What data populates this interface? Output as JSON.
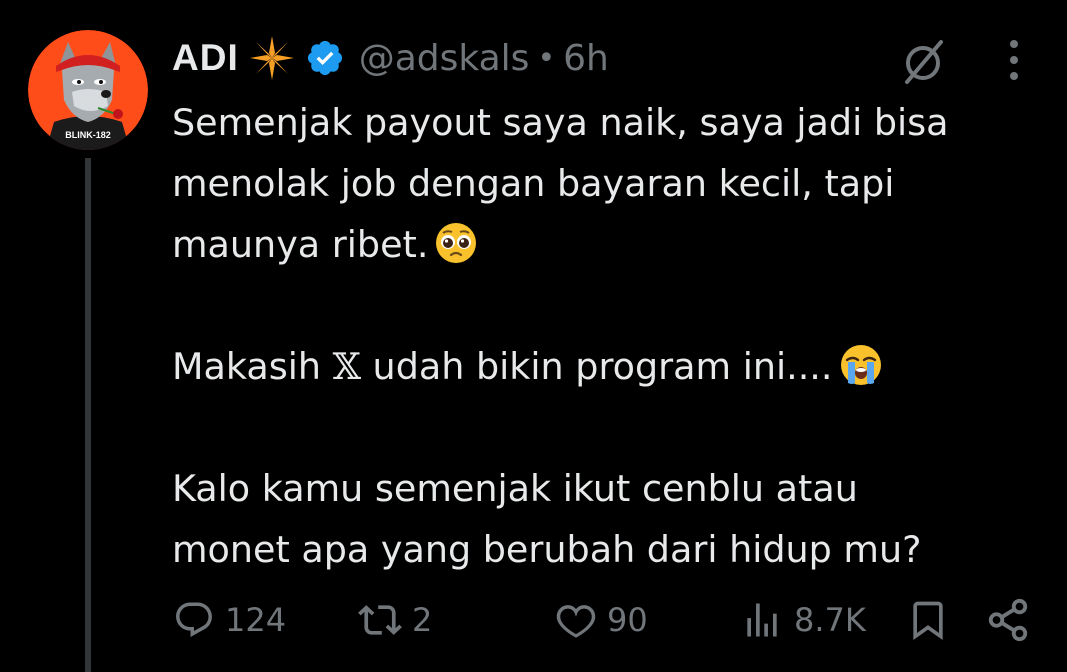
{
  "author": {
    "display_name": "ADI",
    "handle": "@adskals",
    "separator": "•",
    "time": "6h",
    "avatar_icon": "wolf-avatar-icon",
    "avatar_bg": "#ff4d1a",
    "avatar_shirt_text": "BLINK-182",
    "badge_star_color": "#f7a025",
    "verified_color": "#1d9bf0"
  },
  "tweet": {
    "line1": "Semenjak payout saya naik, saya jadi bisa",
    "line2": "menolak job dengan bayaran kecil, tapi",
    "line3": "maunya ribet.",
    "line4_before": "Makasih ",
    "line4_x": "𝕏",
    "line4_after": " udah bikin program ini....",
    "line5": "Kalo kamu semenjak ikut cenblu atau",
    "line6": "monet apa yang berubah dari hidup mu?"
  },
  "actions": {
    "replies": "124",
    "reposts": "2",
    "likes": "90",
    "views": "8.7K"
  },
  "colors": {
    "background": "#000000",
    "text": "#e7e9ea",
    "muted": "#71767b",
    "thread_line": "#333639"
  }
}
